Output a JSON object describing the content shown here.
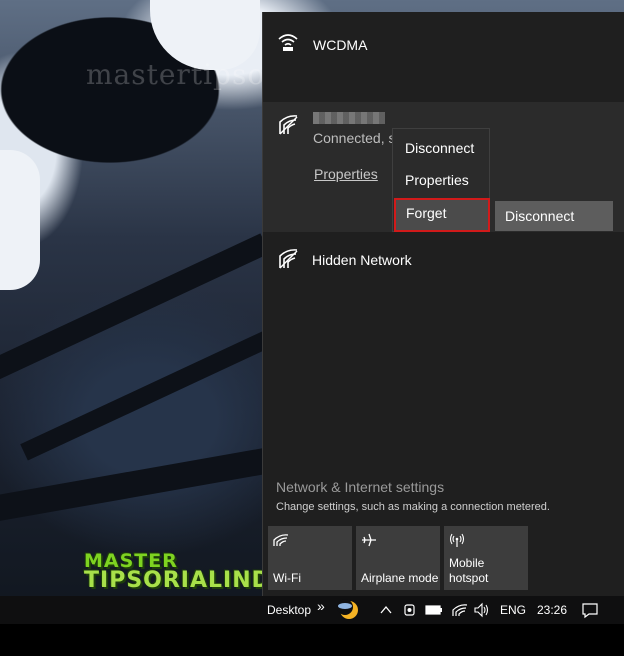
{
  "watermark": "mastertipsorialindo.blogspot.com",
  "logo": {
    "line1": "MASTER",
    "line2": "TIPSORIALINDO"
  },
  "flyout": {
    "networks": [
      {
        "name": "WCDMA",
        "icon": "wifi-signal-icon"
      },
      {
        "name": "",
        "status": "Connected, s",
        "icon": "wifi-secured-icon",
        "properties_link": "Properties",
        "disconnect_button": "Disconnect"
      },
      {
        "name": "Hidden Network",
        "icon": "wifi-secured-icon"
      }
    ],
    "settings_title": "Network & Internet settings",
    "settings_subtitle": "Change settings, such as making a connection metered.",
    "tiles": [
      {
        "label": "Wi-Fi",
        "icon": "wifi-icon"
      },
      {
        "label": "Airplane mode",
        "icon": "airplane-icon"
      },
      {
        "label_line1": "Mobile",
        "label_line2": "hotspot",
        "icon": "hotspot-icon"
      }
    ]
  },
  "context_menu": {
    "items": [
      "Disconnect",
      "Properties",
      "Forget"
    ]
  },
  "taskbar": {
    "desktop_label": "Desktop",
    "chevron": "»",
    "language": "ENG",
    "time": "23:26"
  }
}
